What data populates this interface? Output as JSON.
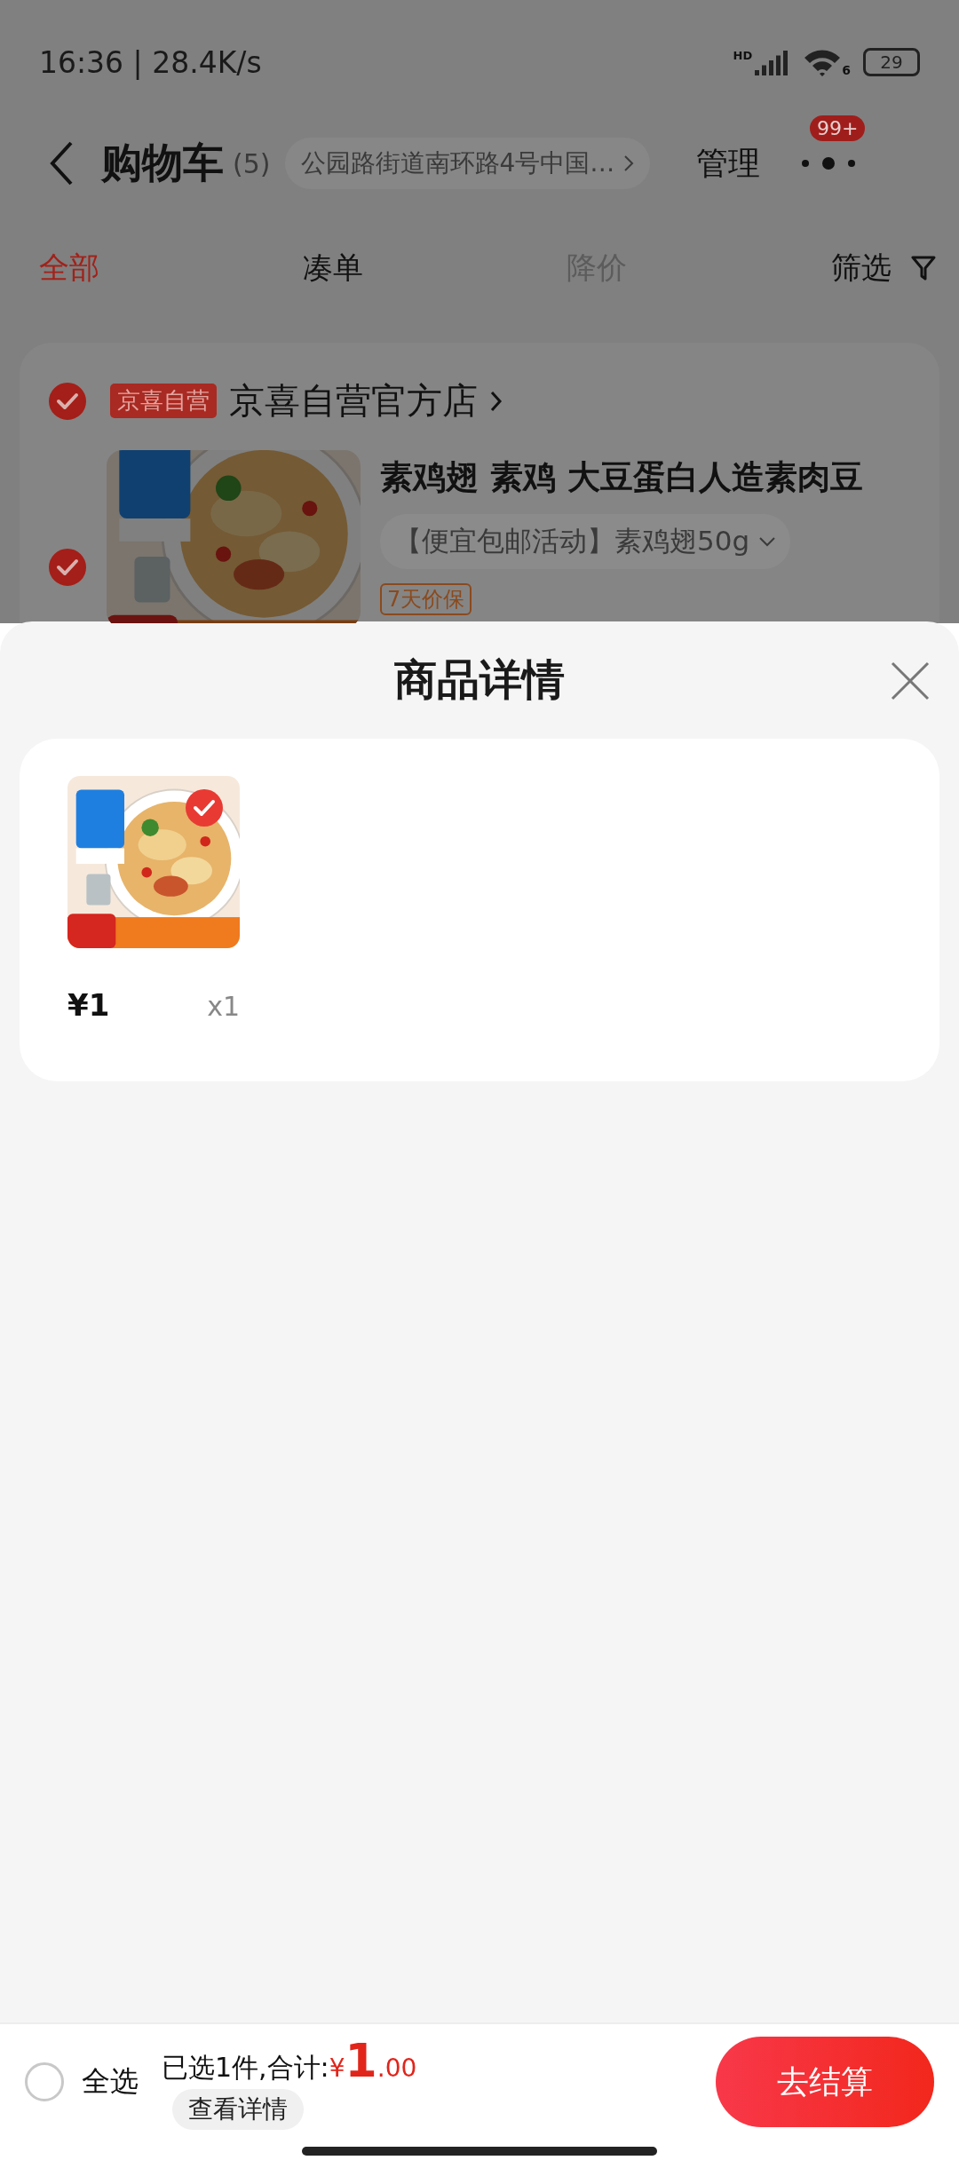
{
  "status_bar": {
    "time": "16:36 | 28.4K/s",
    "signal_label": "HD",
    "wifi_label": "6",
    "battery": "29"
  },
  "header": {
    "title": "购物车",
    "count": "(5)",
    "address": "公园路街道南环路4号中国…",
    "manage": "管理",
    "badge": "99+"
  },
  "tabs": [
    {
      "label": "全部",
      "selected": true,
      "disabled": false
    },
    {
      "label": "凑单",
      "selected": false,
      "disabled": false
    },
    {
      "label": "降价",
      "selected": false,
      "disabled": true
    }
  ],
  "filter": "筛选",
  "store": {
    "checked": true,
    "tag": "京喜自营",
    "name": "京喜自营官方店",
    "item": {
      "checked": true,
      "title": "素鸡翅 素鸡 大豆蛋白人造素肉豆",
      "spec": "【便宜包邮活动】素鸡翅50g",
      "badge": "7天价保"
    }
  },
  "sheet": {
    "title": "商品详情",
    "items": [
      {
        "selected": true,
        "price": "¥1",
        "quantity": "x1"
      }
    ]
  },
  "footer": {
    "select_all": "全选",
    "all_checked": false,
    "summary": "已选1件,合计:",
    "currency": "¥",
    "amount_int": "1",
    "amount_dec": ".00",
    "details": "查看详情",
    "checkout": "去结算"
  }
}
